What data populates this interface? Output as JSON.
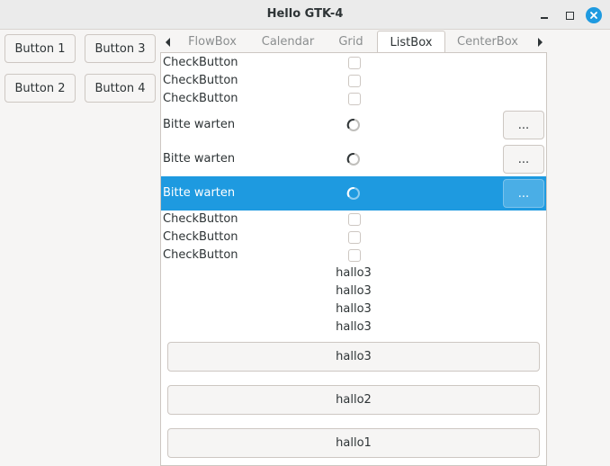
{
  "window": {
    "title": "Hello GTK-4"
  },
  "buttons": [
    "Button 1",
    "Button 3",
    "Button 2",
    "Button 4"
  ],
  "tabs": [
    "FlowBox",
    "Calendar",
    "Grid",
    "ListBox",
    "CenterBox"
  ],
  "active_tab": "ListBox",
  "list": {
    "check_label": "CheckButton",
    "wait_label": "Bitte warten",
    "dots_label": "...",
    "hallo_rows": [
      "hallo3",
      "hallo3",
      "hallo3",
      "hallo3"
    ],
    "big_buttons": [
      "hallo3",
      "hallo2",
      "hallo1"
    ]
  },
  "colors": {
    "accent": "#1e9ae0"
  }
}
